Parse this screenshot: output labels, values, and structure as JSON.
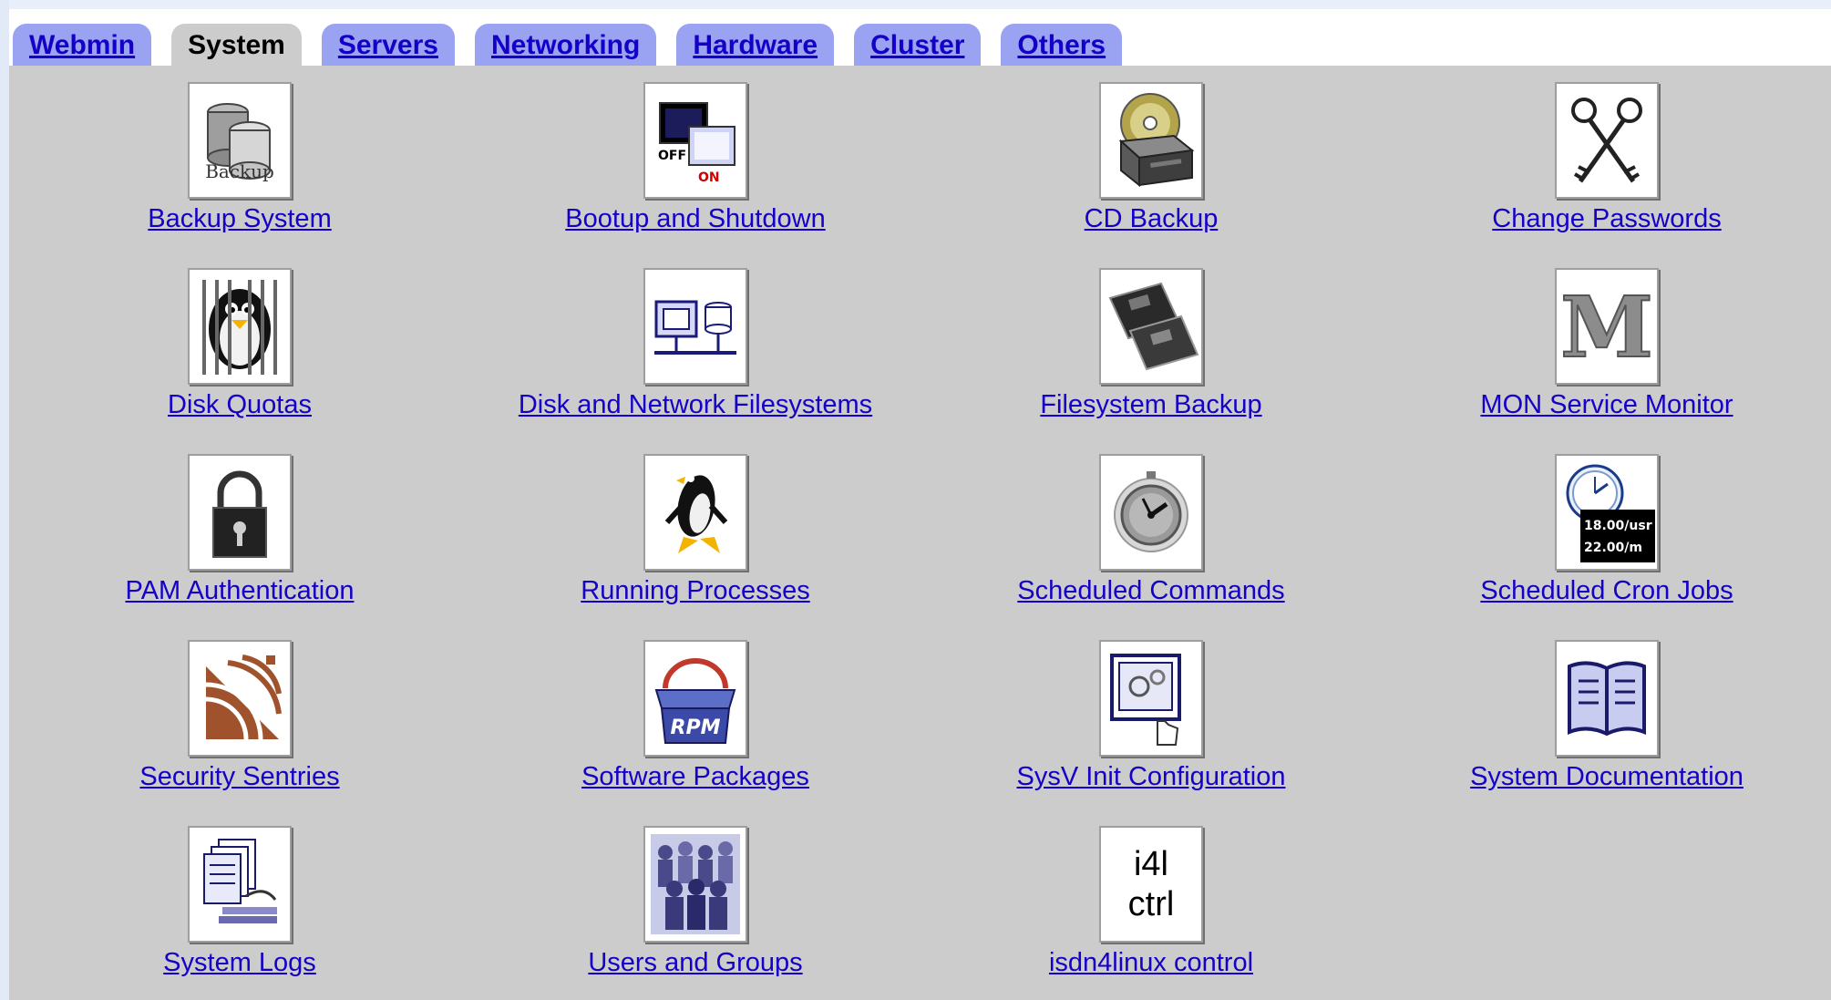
{
  "tabs": [
    {
      "label": "Webmin",
      "active": false
    },
    {
      "label": "System",
      "active": true
    },
    {
      "label": "Servers",
      "active": false
    },
    {
      "label": "Networking",
      "active": false
    },
    {
      "label": "Hardware",
      "active": false
    },
    {
      "label": "Cluster",
      "active": false
    },
    {
      "label": "Others",
      "active": false
    }
  ],
  "modules": [
    {
      "label": "Backup System",
      "icon": "backup-database-icon"
    },
    {
      "label": "Bootup and Shutdown",
      "icon": "bootup-shutdown-icon"
    },
    {
      "label": "CD Backup",
      "icon": "cd-drive-icon"
    },
    {
      "label": "Change Passwords",
      "icon": "keys-icon"
    },
    {
      "label": "Disk Quotas",
      "icon": "penguin-jail-icon"
    },
    {
      "label": "Disk and Network Filesystems",
      "icon": "filesystem-network-icon"
    },
    {
      "label": "Filesystem Backup",
      "icon": "tape-cartridge-icon"
    },
    {
      "label": "MON Service Monitor",
      "icon": "letter-m-icon"
    },
    {
      "label": "PAM Authentication",
      "icon": "padlock-icon"
    },
    {
      "label": "Running Processes",
      "icon": "running-penguin-icon"
    },
    {
      "label": "Scheduled Commands",
      "icon": "stopwatch-icon"
    },
    {
      "label": "Scheduled Cron Jobs",
      "icon": "clock-schedule-icon"
    },
    {
      "label": "Security Sentries",
      "icon": "sentry-waves-icon"
    },
    {
      "label": "Software Packages",
      "icon": "rpm-package-icon"
    },
    {
      "label": "SysV Init Configuration",
      "icon": "init-monitor-icon"
    },
    {
      "label": "System Documentation",
      "icon": "open-book-icon"
    },
    {
      "label": "System Logs",
      "icon": "log-pages-icon"
    },
    {
      "label": "Users and Groups",
      "icon": "crowd-icon"
    },
    {
      "label": "isdn4linux control",
      "icon": "i4l-ctrl-icon"
    }
  ],
  "icon_text": {
    "backup": "Backup",
    "off": "OFF",
    "on": "ON",
    "rpm": "RPM",
    "m": "M",
    "cron1": "18.00/usr",
    "cron2": "22.00/m",
    "i4l_line1": "i4l",
    "i4l_line2": "ctrl"
  },
  "colors": {
    "link": "#1500c8",
    "tab_inactive": "#9aa3f2",
    "tab_active": "#cccccc",
    "panel": "#cccccc"
  }
}
